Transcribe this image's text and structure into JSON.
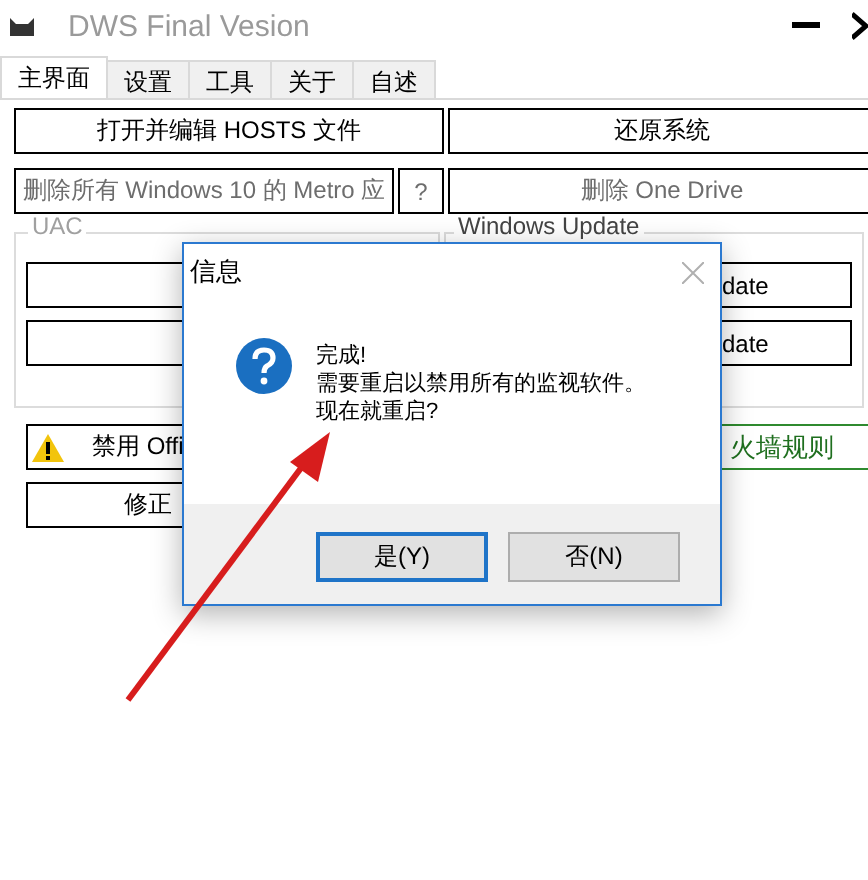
{
  "window": {
    "title": "DWS Final Vesion"
  },
  "tabs": [
    {
      "label": "主界面",
      "selected": true
    },
    {
      "label": "设置",
      "selected": false
    },
    {
      "label": "工具",
      "selected": false
    },
    {
      "label": "关于",
      "selected": false
    },
    {
      "label": "自述",
      "selected": false
    }
  ],
  "top_buttons": [
    {
      "label": "打开并编辑 HOSTS 文件",
      "disabled": false,
      "kind": "left"
    },
    {
      "label": "还原系统",
      "disabled": false,
      "kind": "right"
    },
    {
      "label": "删除所有 Windows 10 的 Metro 应",
      "disabled": true,
      "kind": "left-wide"
    },
    {
      "label": "?",
      "disabled": true,
      "kind": "help"
    },
    {
      "label": "删除 One Drive",
      "disabled": true,
      "kind": "right"
    }
  ],
  "groups": [
    {
      "title": "UAC"
    },
    {
      "title": "Windows Update",
      "buttons": [
        {
          "label": "date"
        },
        {
          "label": "date"
        }
      ]
    }
  ],
  "bottom_left": [
    {
      "label": "禁用 Offi",
      "kind": "warning"
    },
    {
      "label": "修正",
      "kind": "plain"
    }
  ],
  "bottom_right": [
    {
      "label": "火墙规则",
      "kind": "green"
    }
  ],
  "dialog": {
    "title": "信息",
    "message": [
      "完成!",
      "需要重启以禁用所有的监视软件。",
      "现在就重启?"
    ],
    "buttons": [
      {
        "label": "是(Y)",
        "selected": true
      },
      {
        "label": "否(N)",
        "selected": false
      }
    ]
  }
}
